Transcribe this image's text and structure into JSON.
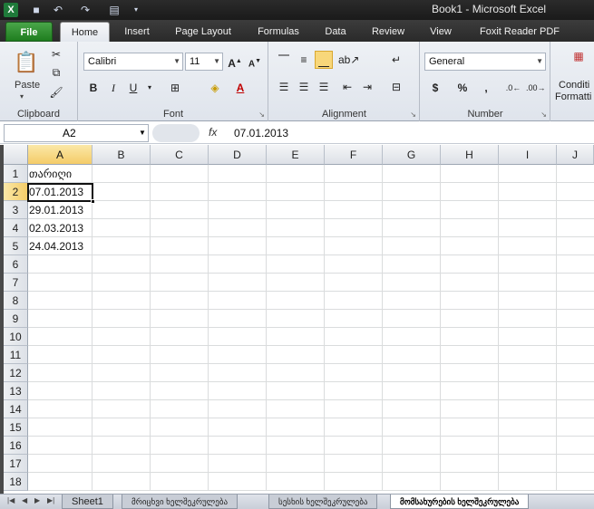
{
  "window": {
    "title": "Book1 - Microsoft Excel",
    "app_icon": "X"
  },
  "ribbon_tabs": [
    {
      "label": "File"
    },
    {
      "label": "Home"
    },
    {
      "label": "Insert"
    },
    {
      "label": "Page Layout"
    },
    {
      "label": "Formulas"
    },
    {
      "label": "Data"
    },
    {
      "label": "Review"
    },
    {
      "label": "View"
    },
    {
      "label": "Foxit Reader PDF"
    }
  ],
  "clipboard": {
    "label": "Clipboard",
    "paste": "Paste"
  },
  "font": {
    "label": "Font",
    "name": "Calibri",
    "size": "11",
    "bold": "B",
    "italic": "I",
    "underline": "U"
  },
  "alignment": {
    "label": "Alignment"
  },
  "number": {
    "label": "Number",
    "format": "General",
    "currency": "$",
    "percent": "%",
    "comma": ","
  },
  "styles": {
    "cond_line1": "Conditi",
    "cond_line2": "Formatti"
  },
  "formula_bar": {
    "name_box": "A2",
    "fx": "fx",
    "value": "07.01.2013"
  },
  "columns": [
    "A",
    "B",
    "C",
    "D",
    "E",
    "F",
    "G",
    "H",
    "I",
    "J"
  ],
  "rows": [
    "1",
    "2",
    "3",
    "4",
    "5",
    "6",
    "7",
    "8",
    "9",
    "10",
    "11",
    "12",
    "13",
    "14",
    "15",
    "16",
    "17",
    "18"
  ],
  "cells": [
    {
      "row": 1,
      "text": "თარიღი"
    },
    {
      "row": 2,
      "text": "07.01.2013"
    },
    {
      "row": 3,
      "text": "29.01.2013"
    },
    {
      "row": 4,
      "text": "02.03.2013"
    },
    {
      "row": 5,
      "text": "24.04.2013"
    }
  ],
  "sheets": [
    {
      "label": "Sheet1"
    },
    {
      "label": "მრიცხვი ხელშეკრულება"
    },
    {
      "label": "სესხის ხელშეკრულება"
    },
    {
      "label": "მომსახურების ხელშეკრულება"
    }
  ],
  "colors": {
    "accent": "#f4cc68",
    "file_tab": "#1e7d1e"
  }
}
